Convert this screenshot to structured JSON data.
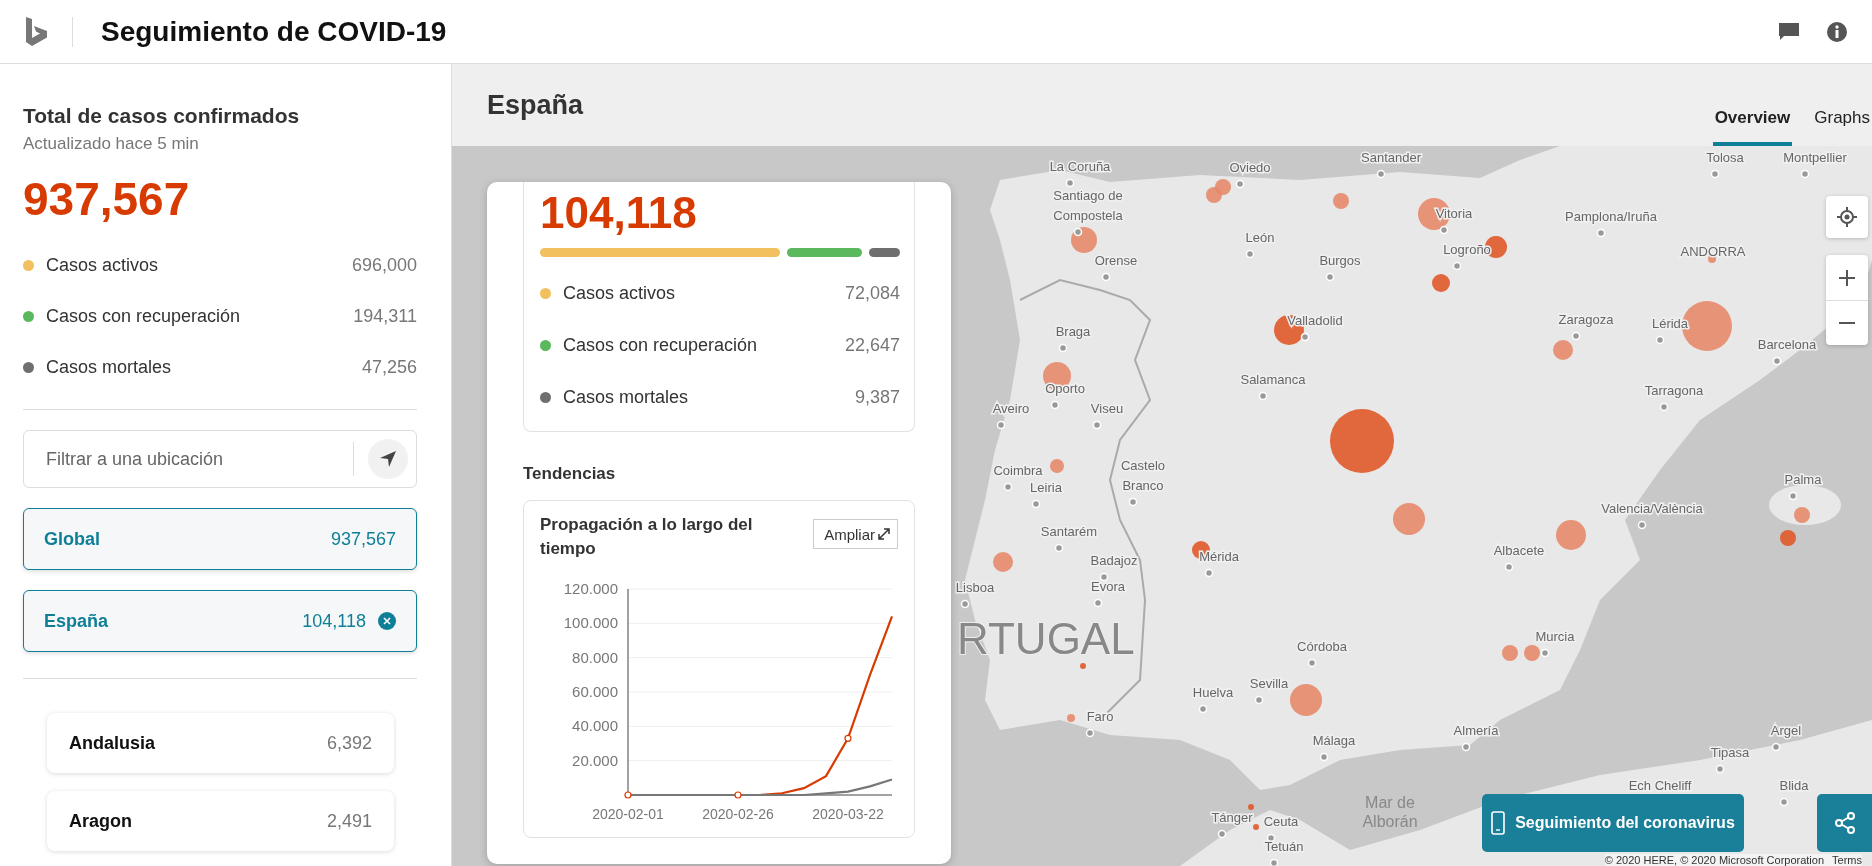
{
  "header": {
    "title": "Seguimiento de COVID-19"
  },
  "sidebar": {
    "title": "Total de casos confirmados",
    "updated": "Actualizado hace 5 min",
    "total": "937,567",
    "stats": [
      {
        "label": "Casos activos",
        "value": "696,000",
        "color": "#f2c05f"
      },
      {
        "label": "Casos con recuperación",
        "value": "194,311",
        "color": "#5cb85c"
      },
      {
        "label": "Casos mortales",
        "value": "47,256",
        "color": "#6f6f6f"
      }
    ],
    "search": {
      "placeholder": "Filtrar a una ubicación"
    },
    "filters": [
      {
        "label": "Global",
        "count": "937,567",
        "removable": false
      },
      {
        "label": "España",
        "count": "104,118",
        "removable": true
      }
    ],
    "regions": [
      {
        "name": "Andalusia",
        "count": "6,392"
      },
      {
        "name": "Aragon",
        "count": "2,491"
      }
    ]
  },
  "main": {
    "title": "España",
    "tabs": [
      {
        "label": "Overview",
        "selected": true
      },
      {
        "label": "Graphs",
        "selected": false
      }
    ]
  },
  "card": {
    "total": "104,118",
    "stats": [
      {
        "label": "Casos activos",
        "value": "72,084",
        "color": "#f2c05f"
      },
      {
        "label": "Casos con recuperación",
        "value": "22,647",
        "color": "#5cb85c"
      },
      {
        "label": "Casos mortales",
        "value": "9,387",
        "color": "#6f6f6f"
      }
    ],
    "trends_title": "Tendencias",
    "chart_title": "Propagación a lo largo del tiempo",
    "expand_label": "Ampliar",
    "chart_data": {
      "type": "line",
      "categories": [
        "2020-02-01",
        null,
        null,
        null,
        null,
        "2020-02-26",
        null,
        null,
        null,
        null,
        "2020-03-22",
        null,
        null
      ],
      "series": [
        {
          "color": "#d83b01",
          "values": [
            0,
            0,
            0,
            0,
            0,
            0,
            0,
            1,
            4,
            11,
            33,
            70,
            104
          ]
        },
        {
          "color": "#777777",
          "values": [
            0,
            0,
            0,
            0,
            0,
            0,
            0,
            0,
            0,
            1,
            2,
            5,
            9
          ]
        }
      ],
      "ylim": [
        0,
        120
      ],
      "grid": true,
      "yticks": [
        {
          "value": 20,
          "label": "20.000"
        },
        {
          "value": 40,
          "label": "40.000"
        },
        {
          "value": 60,
          "label": "60.000"
        },
        {
          "value": 80,
          "label": "80.000"
        },
        {
          "value": 100,
          "label": "100.000"
        },
        {
          "value": 120,
          "label": "120.000"
        }
      ]
    }
  },
  "map": {
    "labels": [
      {
        "text": "La Coruña",
        "kind": "city"
      },
      {
        "text": "Oviedo",
        "kind": "city"
      },
      {
        "text": "Santander",
        "kind": "city"
      },
      {
        "text": "Tolosa",
        "kind": "city"
      },
      {
        "text": "Montpellier",
        "kind": "city"
      },
      {
        "text": "Santiago de",
        "kind": "line"
      },
      {
        "text": "Compostela",
        "kind": "city"
      },
      {
        "text": "Vitoria",
        "kind": "city"
      },
      {
        "text": "Pamplona/Iruña",
        "kind": "city"
      },
      {
        "text": "León",
        "kind": "city"
      },
      {
        "text": "Orense",
        "kind": "city"
      },
      {
        "text": "Burgos",
        "kind": "city"
      },
      {
        "text": "Logroño",
        "kind": "city"
      },
      {
        "text": "ANDORRA",
        "kind": "line"
      },
      {
        "text": "Valladolid",
        "kind": "city"
      },
      {
        "text": "Zaragoza",
        "kind": "city"
      },
      {
        "text": "Lérida",
        "kind": "city"
      },
      {
        "text": "Barcelona",
        "kind": "city"
      },
      {
        "text": "Braga",
        "kind": "city"
      },
      {
        "text": "Oporto",
        "kind": "city"
      },
      {
        "text": "Salamanca",
        "kind": "city"
      },
      {
        "text": "Tarragona",
        "kind": "city"
      },
      {
        "text": "Aveiro",
        "kind": "city"
      },
      {
        "text": "Viseu",
        "kind": "city"
      },
      {
        "text": "Coimbra",
        "kind": "city"
      },
      {
        "text": "Leiria",
        "kind": "city"
      },
      {
        "text": "Castelo",
        "kind": "line"
      },
      {
        "text": "Branco",
        "kind": "city"
      },
      {
        "text": "Palma",
        "kind": "city"
      },
      {
        "text": "Valencia/València",
        "kind": "city"
      },
      {
        "text": "Santarém",
        "kind": "city"
      },
      {
        "text": "Badajoz",
        "kind": "city"
      },
      {
        "text": "Mérida",
        "kind": "city"
      },
      {
        "text": "Albacete",
        "kind": "city"
      },
      {
        "text": "Lisboa",
        "kind": "city"
      },
      {
        "text": "Evora",
        "kind": "city"
      },
      {
        "text": "RTUGAL",
        "kind": "country"
      },
      {
        "text": "Murcia",
        "kind": "city"
      },
      {
        "text": "Córdoba",
        "kind": "city"
      },
      {
        "text": "Sevilla",
        "kind": "city"
      },
      {
        "text": "Huelva",
        "kind": "city"
      },
      {
        "text": "Faro",
        "kind": "city"
      },
      {
        "text": "Almería",
        "kind": "city"
      },
      {
        "text": "Málaga",
        "kind": "city"
      },
      {
        "text": "Argel",
        "kind": "city"
      },
      {
        "text": "Tipasa",
        "kind": "city"
      },
      {
        "text": "Ech Cheliff",
        "kind": "line"
      },
      {
        "text": "Blida",
        "kind": "city"
      },
      {
        "text": "Tánger",
        "kind": "city"
      },
      {
        "text": "Ceuta",
        "kind": "city"
      },
      {
        "text": "Mar de",
        "kind": "sea"
      },
      {
        "text": "Alborán",
        "kind": "sea"
      },
      {
        "text": "Tetuán",
        "kind": "city"
      }
    ],
    "tracker_button": "Seguimiento del coronavirus",
    "copyright": "© 2020 HERE, © 2020 Microsoft Corporation",
    "terms": "Terms"
  }
}
